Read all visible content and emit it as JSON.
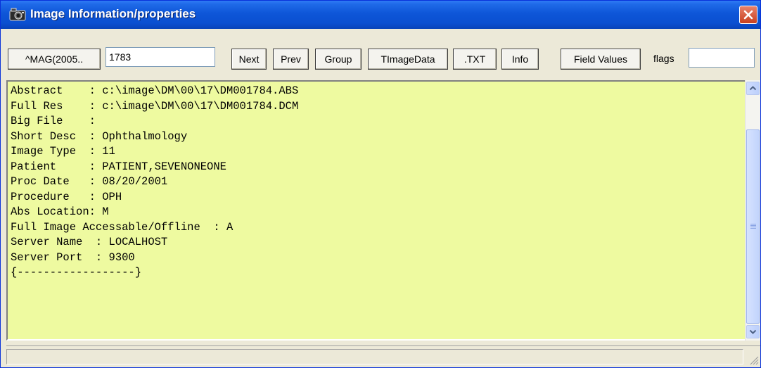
{
  "window": {
    "title": "Image Information/properties",
    "icon": "camera-icon",
    "close_icon": "close-icon",
    "accent_color": "#0a4fd0",
    "close_color": "#c8401f"
  },
  "toolbar": {
    "mag_button": "^MAG(2005..",
    "ien_value": "1783",
    "next_label": "Next",
    "prev_label": "Prev",
    "group_label": "Group",
    "timagedata_label": "TImageData",
    "txt_label": ".TXT",
    "info_label": "Info",
    "field_values_label": "Field Values",
    "flags_label": "flags",
    "flags_value": ""
  },
  "content": {
    "background_color": "#eefaa0",
    "lines": [
      "Abstract    : c:\\image\\DM\\00\\17\\DM001784.ABS",
      "Full Res    : c:\\image\\DM\\00\\17\\DM001784.DCM",
      "Big File    :",
      "Short Desc  : Ophthalmology",
      "Image Type  : 11",
      "Patient     : PATIENT,SEVENONEONE",
      "Proc Date   : 08/20/2001",
      "Procedure   : OPH",
      "Abs Location: M",
      "Full Image Accessable/Offline  : A",
      "Server Name  : LOCALHOST",
      "Server Port  : 9300",
      "{------------------}"
    ]
  },
  "status": {
    "text": ""
  }
}
